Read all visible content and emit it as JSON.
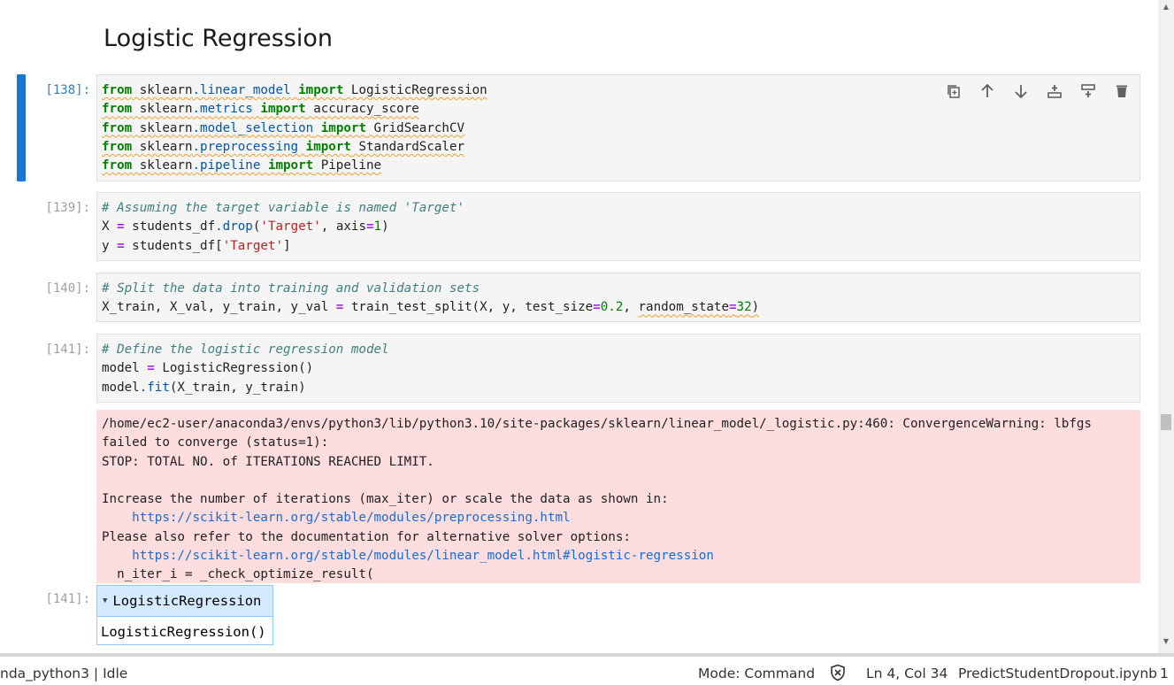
{
  "heading": "Logistic Regression",
  "cells": [
    {
      "prompt": "[138]:",
      "lines": [
        "from sklearn.linear_model import LogisticRegression",
        "from sklearn.metrics import accuracy_score",
        "from sklearn.model_selection import GridSearchCV",
        "from sklearn.preprocessing import StandardScaler",
        "from sklearn.pipeline import Pipeline"
      ]
    },
    {
      "prompt": "[139]:",
      "lines": [
        "# Assuming the target variable is named 'Target'",
        "X = students_df.drop('Target', axis=1)",
        "y = students_df['Target']"
      ]
    },
    {
      "prompt": "[140]:",
      "lines": [
        "# Split the data into training and validation sets",
        "X_train, X_val, y_train, y_val = train_test_split(X, y, test_size=0.2, random_state=32)"
      ]
    },
    {
      "prompt": "[141]:",
      "lines": [
        "# Define the logistic regression model",
        "model = LogisticRegression()",
        "model.fit(X_train, y_train)"
      ]
    }
  ],
  "stderr": {
    "lines": [
      "/home/ec2-user/anaconda3/envs/python3/lib/python3.10/site-packages/sklearn/linear_model/_logistic.py:460: ConvergenceWarning: lbfgs",
      "failed to converge (status=1):",
      "STOP: TOTAL NO. of ITERATIONS REACHED LIMIT.",
      "",
      "Increase the number of iterations (max_iter) or scale the data as shown in:",
      "    https://scikit-learn.org/stable/modules/preprocessing.html",
      "Please also refer to the documentation for alternative solver options:",
      "    https://scikit-learn.org/stable/modules/linear_model.html#logistic-regression",
      "  n_iter_i = _check_optimize_result("
    ]
  },
  "output": {
    "prompt": "[141]:",
    "widget_title": "LogisticRegression",
    "widget_body": "LogisticRegression()"
  },
  "toolbar": {
    "icons": [
      "duplicate-icon",
      "move-up-icon",
      "move-down-icon",
      "insert-above-icon",
      "insert-below-icon",
      "delete-icon"
    ]
  },
  "statusbar": {
    "kernel": "nda_python3 | Idle",
    "mode": "Mode: Command",
    "position": "Ln 4, Col 34",
    "file": "PredictStudentDropout.ipynb",
    "extra": "1"
  }
}
